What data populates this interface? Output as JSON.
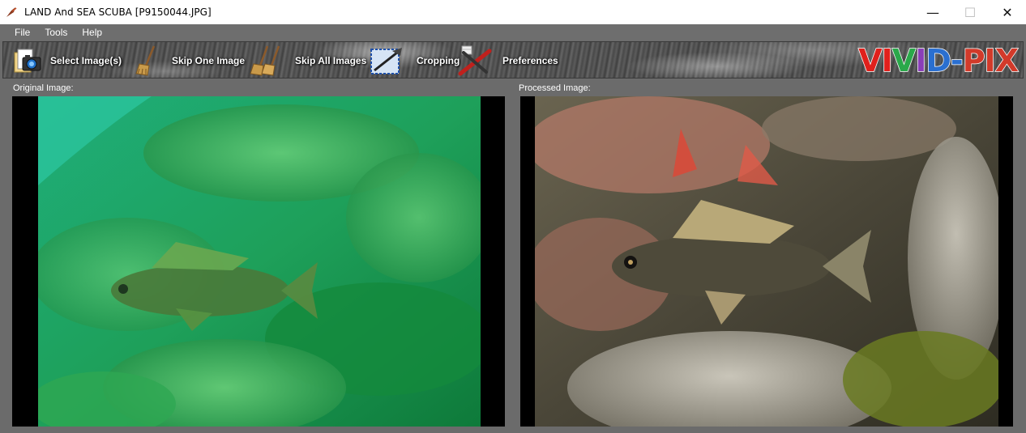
{
  "window": {
    "title": "LAND And SEA SCUBA  [P9150044.JPG]",
    "controls": {
      "minimize": "—",
      "maximize": "☐",
      "close": "✕"
    }
  },
  "menu": {
    "items": [
      {
        "label": "File"
      },
      {
        "label": "Tools"
      },
      {
        "label": "Help"
      }
    ]
  },
  "toolbar": {
    "select": "Select Image(s)",
    "skip_one": "Skip One Image",
    "skip_all": "Skip All Images",
    "cropping": "Cropping",
    "preferences": "Preferences"
  },
  "logo": {
    "letters": [
      {
        "ch": "V",
        "color": "#e0201c"
      },
      {
        "ch": "I",
        "color": "#e0201c"
      },
      {
        "ch": "V",
        "color": "#2aa84a"
      },
      {
        "ch": "I",
        "color": "#8a3fb8"
      },
      {
        "ch": "D",
        "color": "#2a6fd0"
      },
      {
        "ch": "-",
        "color": "#2a6fd0"
      },
      {
        "ch": "P",
        "color": "#d23a2a"
      },
      {
        "ch": "I",
        "color": "#d23a2a"
      },
      {
        "ch": "X",
        "color": "#d23a2a"
      }
    ]
  },
  "panels": {
    "original_label": "Original Image:",
    "processed_label": "Processed Image:"
  }
}
